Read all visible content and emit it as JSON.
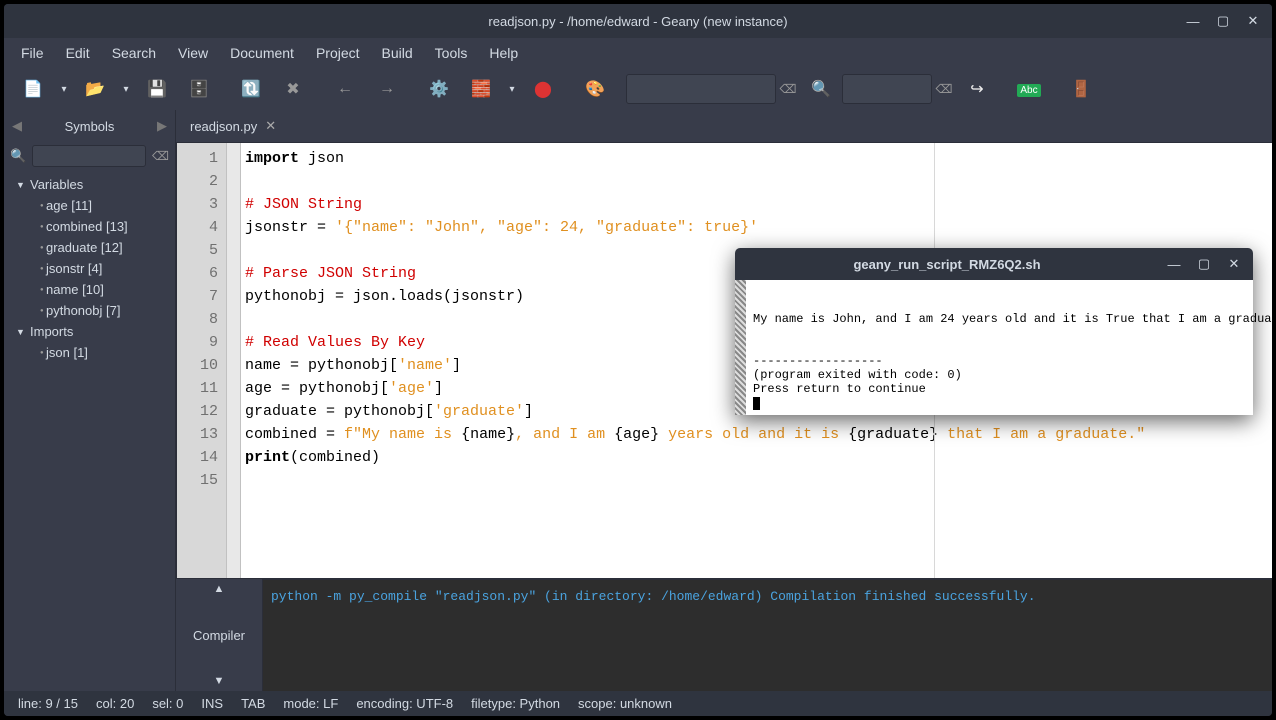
{
  "title": "readjson.py - /home/edward - Geany (new instance)",
  "menus": [
    "File",
    "Edit",
    "Search",
    "View",
    "Document",
    "Project",
    "Build",
    "Tools",
    "Help"
  ],
  "sidebar": {
    "tab": "Symbols",
    "groups": [
      {
        "name": "Variables",
        "expanded": true,
        "items": [
          "age [11]",
          "combined [13]",
          "graduate [12]",
          "jsonstr [4]",
          "name [10]",
          "pythonobj [7]"
        ]
      },
      {
        "name": "Imports",
        "expanded": true,
        "items": [
          "json [1]"
        ]
      }
    ]
  },
  "tab": {
    "name": "readjson.py"
  },
  "code": {
    "lines": [
      {
        "n": 1,
        "seg": [
          {
            "c": "kw",
            "t": "import"
          },
          {
            "c": "",
            "t": " json"
          }
        ]
      },
      {
        "n": 2,
        "seg": []
      },
      {
        "n": 3,
        "seg": [
          {
            "c": "com",
            "t": "# JSON String"
          }
        ]
      },
      {
        "n": 4,
        "seg": [
          {
            "c": "",
            "t": "jsonstr = "
          },
          {
            "c": "str",
            "t": "'{\"name\": \"John\", \"age\": 24, \"graduate\": true}'"
          }
        ]
      },
      {
        "n": 5,
        "seg": []
      },
      {
        "n": 6,
        "seg": [
          {
            "c": "com",
            "t": "# Parse JSON String"
          }
        ]
      },
      {
        "n": 7,
        "seg": [
          {
            "c": "",
            "t": "pythonobj = json.loads(jsonstr)"
          }
        ]
      },
      {
        "n": 8,
        "seg": []
      },
      {
        "n": 9,
        "seg": [
          {
            "c": "com",
            "t": "# Read Values By Key"
          }
        ]
      },
      {
        "n": 10,
        "seg": [
          {
            "c": "",
            "t": "name = pythonobj["
          },
          {
            "c": "str",
            "t": "'name'"
          },
          {
            "c": "",
            "t": "]"
          }
        ]
      },
      {
        "n": 11,
        "seg": [
          {
            "c": "",
            "t": "age = pythonobj["
          },
          {
            "c": "str",
            "t": "'age'"
          },
          {
            "c": "",
            "t": "]"
          }
        ]
      },
      {
        "n": 12,
        "seg": [
          {
            "c": "",
            "t": "graduate = pythonobj["
          },
          {
            "c": "str",
            "t": "'graduate'"
          },
          {
            "c": "",
            "t": "]"
          }
        ]
      },
      {
        "n": 13,
        "seg": [
          {
            "c": "",
            "t": "combined = "
          },
          {
            "c": "str",
            "t": "f\"My name is "
          },
          {
            "c": "",
            "t": "{name}"
          },
          {
            "c": "str",
            "t": ", and I am "
          },
          {
            "c": "",
            "t": "{age}"
          },
          {
            "c": "str",
            "t": " years old and it is "
          },
          {
            "c": "",
            "t": "{graduate}"
          },
          {
            "c": "str",
            "t": " that I am a graduate.\""
          }
        ]
      },
      {
        "n": 14,
        "seg": [
          {
            "c": "fn",
            "t": "print"
          },
          {
            "c": "",
            "t": "(combined)"
          }
        ]
      },
      {
        "n": 15,
        "seg": []
      }
    ]
  },
  "compiler": {
    "tab": "Compiler",
    "out": "python -m py_compile \"readjson.py\" (in directory: /home/edward)\nCompilation finished successfully."
  },
  "status": {
    "pos": "line: 9 / 15",
    "col": "col: 20",
    "sel": "sel: 0",
    "ins": "INS",
    "tab": "TAB",
    "mode": "mode: LF",
    "enc": "encoding: UTF-8",
    "ft": "filetype: Python",
    "scope": "scope: unknown"
  },
  "term": {
    "title": "geany_run_script_RMZ6Q2.sh",
    "out": "My name is John, and I am 24 years old and it is True that I am a graduate.\n\n\n------------------\n(program exited with code: 0)\nPress return to continue"
  }
}
